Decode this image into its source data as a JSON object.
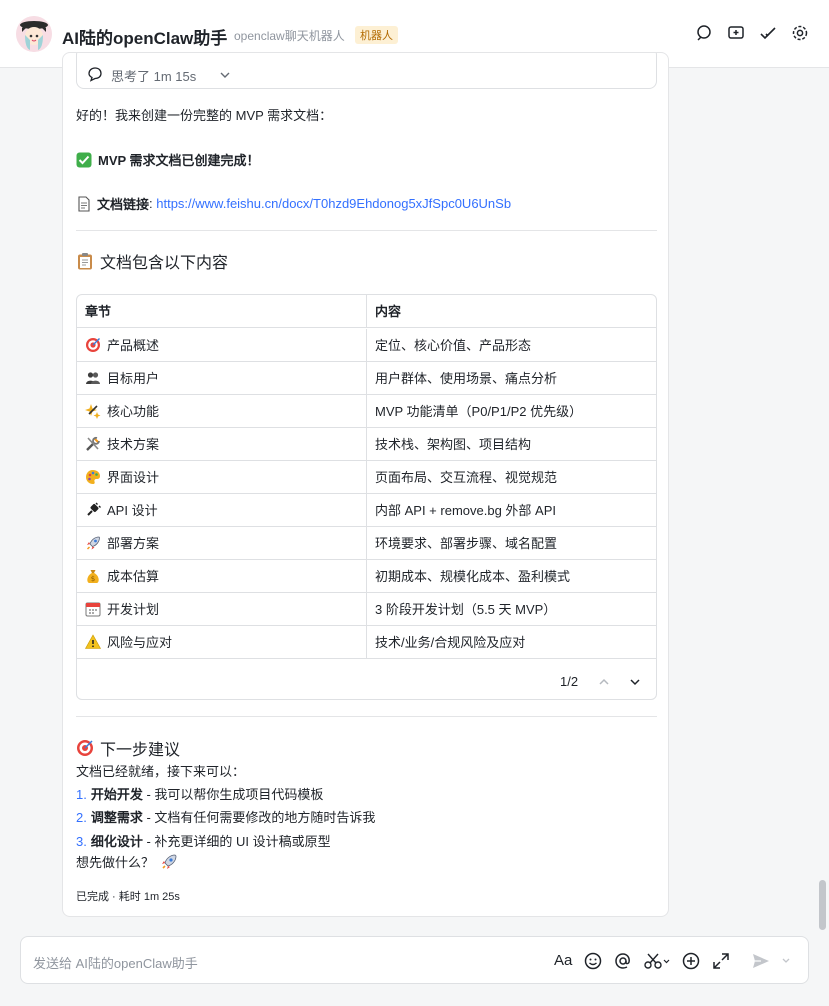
{
  "header": {
    "title": "AI陆的openClaw助手",
    "subtitle": "openclaw聊天机器人",
    "badge": "机器人",
    "icons": [
      "search-chat-icon",
      "add-tab-icon",
      "check-icon",
      "settings-icon"
    ]
  },
  "message": {
    "thinking_label": "思考了 1m 15s",
    "intro": "好的！我来创建一份完整的 MVP 需求文档：",
    "created": "MVP 需求文档已创建完成！",
    "doc_link_label": "文档链接",
    "doc_link_sep": ": ",
    "doc_link_url": "https://www.feishu.cn/docx/T0hzd9Ehdonog5xJfSpc0U6UnSb",
    "section_title": "文档包含以下内容",
    "table": {
      "headers": [
        "章节",
        "内容"
      ],
      "rows": [
        {
          "icon": "target-icon",
          "chapter": "产品概述",
          "content": "定位、核心价值、产品形态"
        },
        {
          "icon": "users-icon",
          "chapter": "目标用户",
          "content": "用户群体、使用场景、痛点分析"
        },
        {
          "icon": "sparkle-icon",
          "chapter": "核心功能",
          "content": "MVP 功能清单（P0/P1/P2 优先级）"
        },
        {
          "icon": "tools-icon",
          "chapter": "技术方案",
          "content": "技术栈、架构图、项目结构"
        },
        {
          "icon": "palette-icon",
          "chapter": "界面设计",
          "content": "页面布局、交互流程、视觉规范"
        },
        {
          "icon": "plug-icon",
          "chapter": "API 设计",
          "content": "内部 API + remove.bg 外部 API"
        },
        {
          "icon": "rocket-icon",
          "chapter": "部署方案",
          "content": "环境要求、部署步骤、域名配置"
        },
        {
          "icon": "money-bag-icon",
          "chapter": "成本估算",
          "content": "初期成本、规模化成本、盈利模式"
        },
        {
          "icon": "calendar-icon",
          "chapter": "开发计划",
          "content": "3 阶段开发计划（5.5 天 MVP）"
        },
        {
          "icon": "warning-icon",
          "chapter": "风险与应对",
          "content": "技术/业务/合规风险及应对"
        }
      ],
      "page": "1/2"
    },
    "next_title": "下一步建议",
    "next_intro": "文档已经就绪，接下来可以：",
    "next_items": [
      {
        "num": "1.",
        "bold": "开始开发",
        "rest": " - 我可以帮你生成项目代码模板"
      },
      {
        "num": "2.",
        "bold": "调整需求",
        "rest": " - 文档有任何需要修改的地方随时告诉我"
      },
      {
        "num": "3.",
        "bold": "细化设计",
        "rest": " - 补充更详细的 UI 设计稿或原型"
      }
    ],
    "closing": "想先做什么？",
    "status": "已完成 · 耗时 1m 25s"
  },
  "composer": {
    "placeholder": "发送给 AI陆的openClaw助手",
    "format_label": "Aa"
  }
}
